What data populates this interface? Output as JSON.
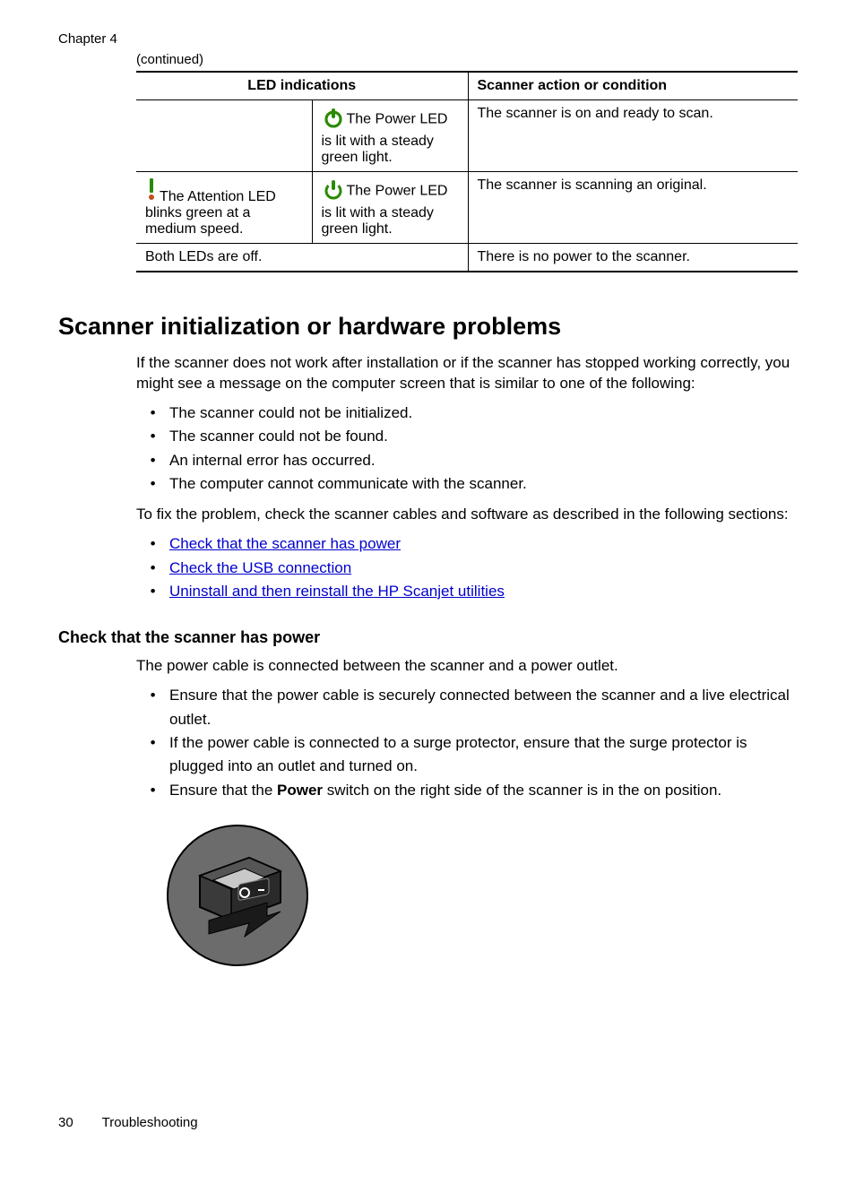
{
  "chapter_label": "Chapter 4",
  "continued": "(continued)",
  "table": {
    "header_led": "LED indications",
    "header_action": "Scanner action or condition",
    "rows": [
      {
        "cell_a": "",
        "cell_b": "The Power LED is lit with a steady green light.",
        "cell_c": "The scanner is on and ready to scan."
      },
      {
        "cell_a": "The Attention LED blinks green at a medium speed.",
        "cell_b": "The Power LED is lit with a steady green light.",
        "cell_c": "The scanner is scanning an original."
      },
      {
        "cell_ab": "Both LEDs are off.",
        "cell_c": "There is no power to the scanner."
      }
    ]
  },
  "heading1": "Scanner initialization or hardware problems",
  "intro_para": "If the scanner does not work after installation or if the scanner has stopped working correctly, you might see a message on the computer screen that is similar to one of the following:",
  "error_list": [
    "The scanner could not be initialized.",
    "The scanner could not be found.",
    "An internal error has occurred.",
    "The computer cannot communicate with the scanner."
  ],
  "fix_para": "To fix the problem, check the scanner cables and software as described in the following sections:",
  "link_list": [
    "Check that the scanner has power",
    "Check the USB connection",
    "Uninstall and then reinstall the HP Scanjet utilities"
  ],
  "heading2": "Check that the scanner has power",
  "power_para": "The power cable is connected between the scanner and a power outlet.",
  "power_list": {
    "item1": "Ensure that the power cable is securely connected between the scanner and a live electrical outlet.",
    "item2": "If the power cable is connected to a surge protector, ensure that the surge protector is plugged into an outlet and turned on.",
    "item3_a": "Ensure that the ",
    "item3_bold": "Power",
    "item3_b": " switch on the right side of the scanner is in the on position."
  },
  "footer": {
    "page_number": "30",
    "section": "Troubleshooting"
  }
}
